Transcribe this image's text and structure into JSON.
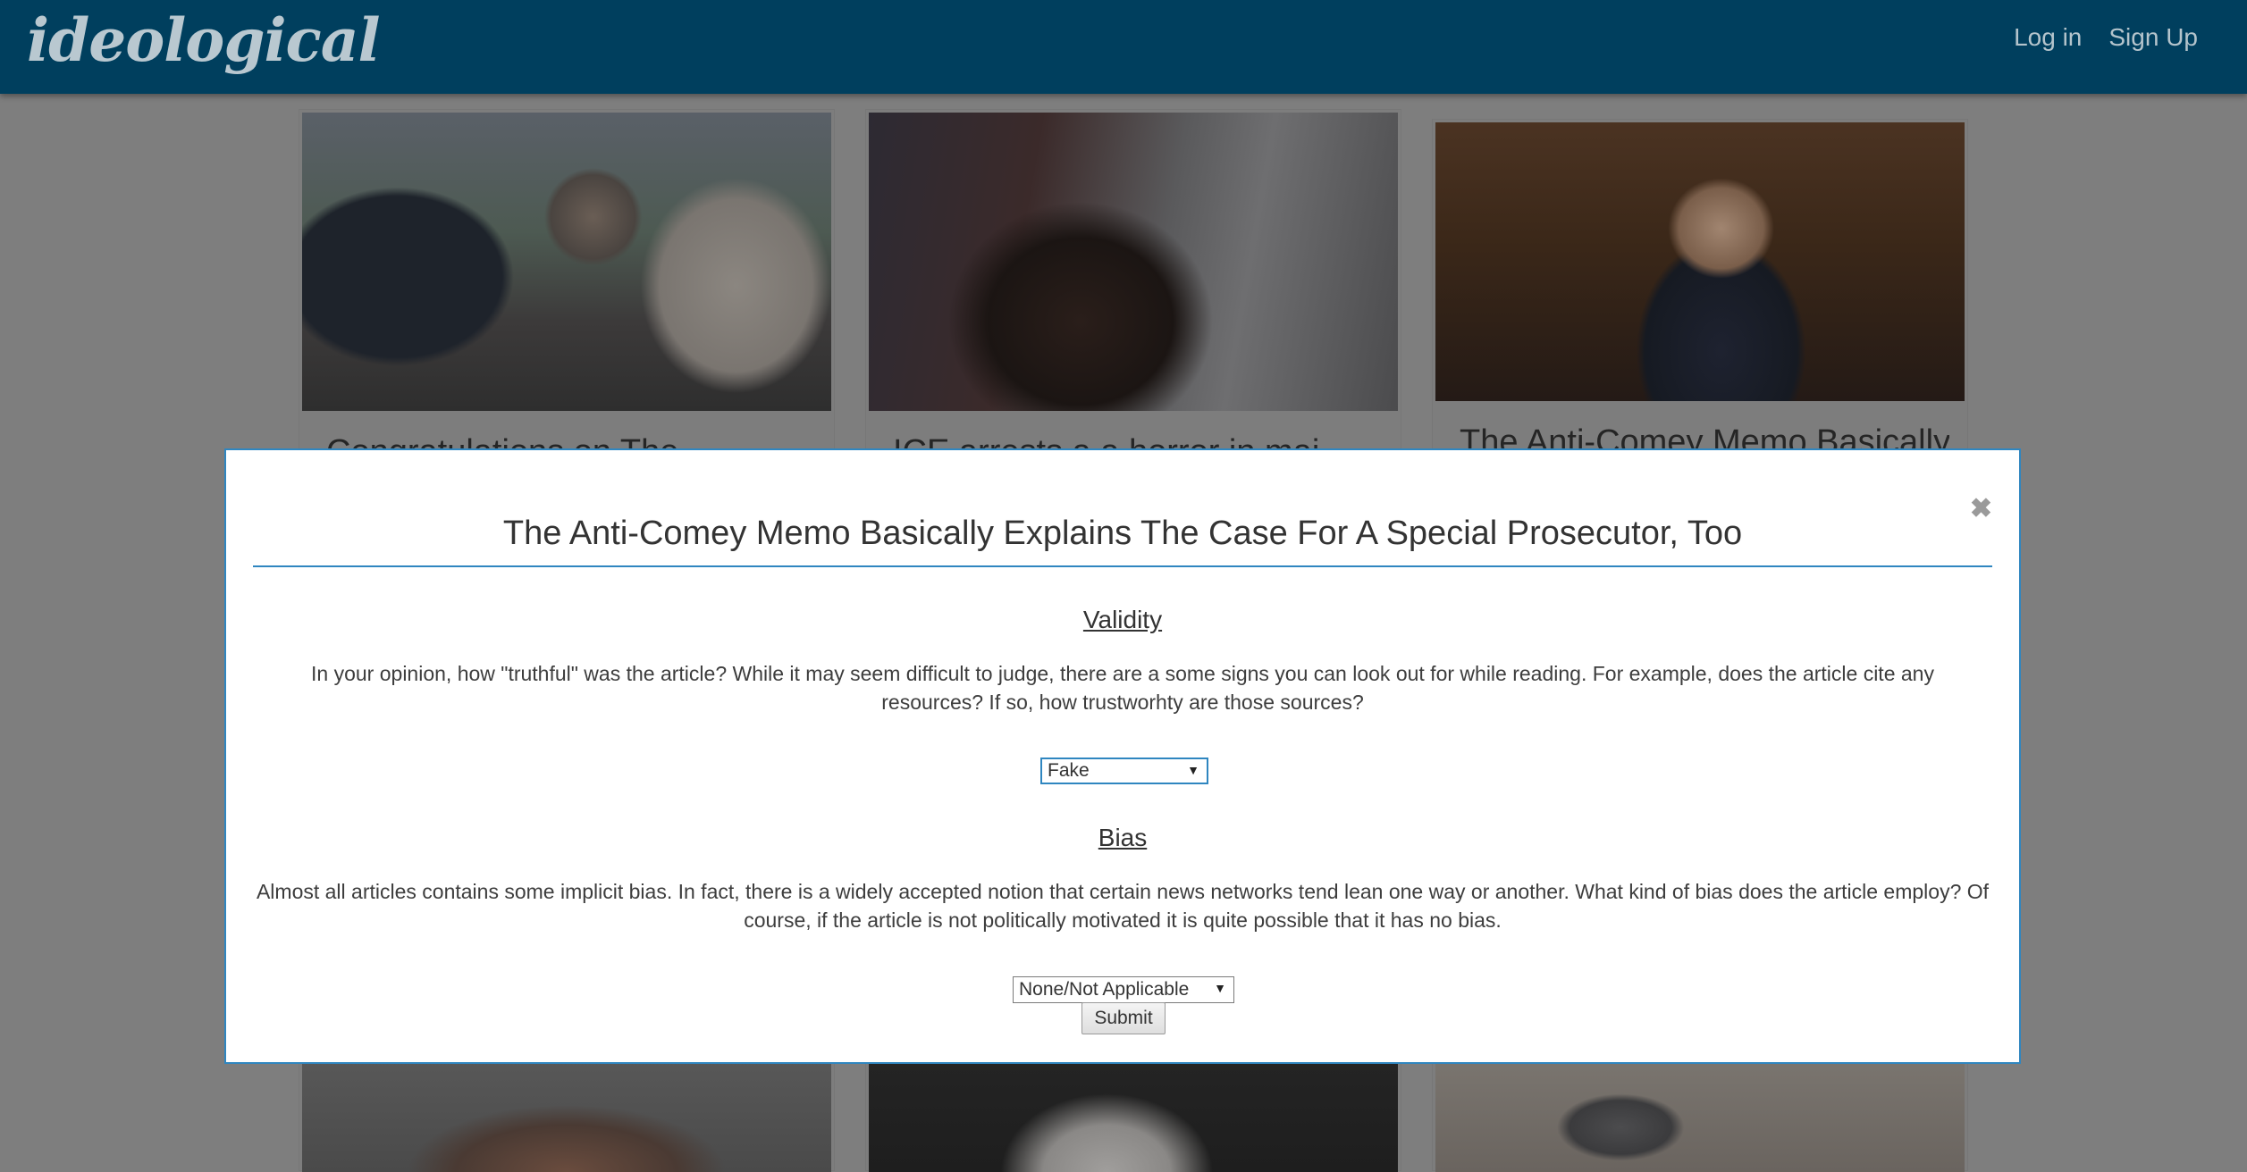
{
  "app": {
    "brand": "ideological"
  },
  "nav": {
    "login_label": "Log in",
    "signup_label": "Sign Up"
  },
  "cards": [
    {
      "title": "Congratulations on The"
    },
    {
      "title": "ICE arrests a a horror in mai"
    },
    {
      "title": "The Anti-Comey Memo Basically"
    }
  ],
  "modal": {
    "title": "The Anti-Comey Memo Basically Explains The Case For A Special Prosecutor, Too",
    "close_glyph": "✖",
    "validity": {
      "heading": "Validity",
      "text": "In your opinion, how \"truthful\" was the article? While it may seem difficult to judge, there are a some signs you can look out for while reading. For example, does the article cite any resources? If so, how trustworhty are those sources?",
      "selected": "Fake"
    },
    "bias": {
      "heading": "Bias",
      "text": "Almost all articles contains some implicit bias. In fact, there is a widely accepted notion that certain news networks tend lean one way or another. What kind of bias does the article employ? Of course, if the article is not politically motivated it is quite possible that it has no bias.",
      "selected": "None/Not Applicable"
    },
    "submit_label": "Submit"
  },
  "colors": {
    "navbar": "#003f5e",
    "accent": "#2f86c0",
    "overlay": "#7e7e7e"
  }
}
